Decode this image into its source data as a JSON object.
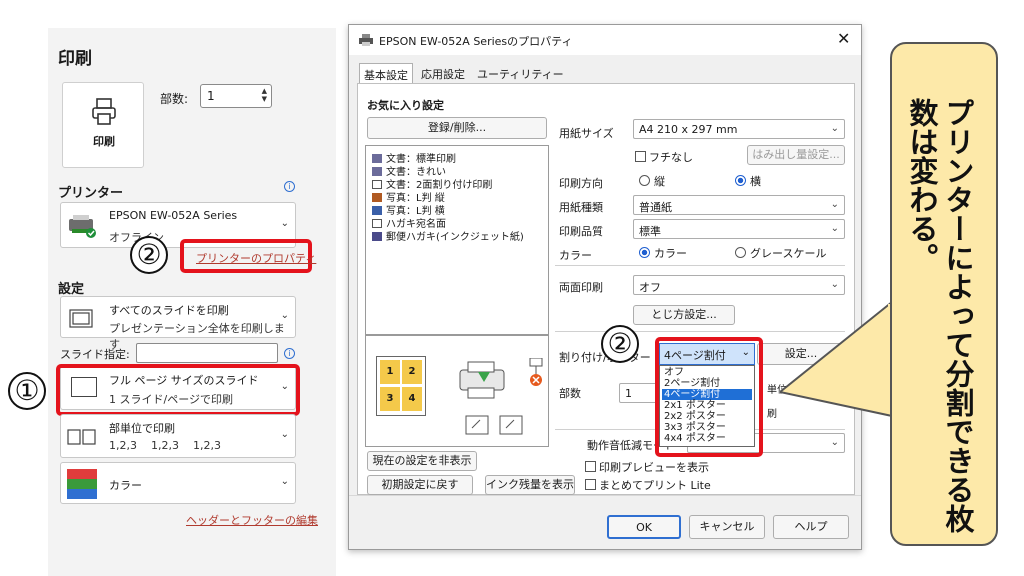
{
  "print_pane": {
    "title": "印刷",
    "print_button_label": "印刷",
    "copies_label": "部数:",
    "copies_value": "1",
    "printer_header": "プリンター",
    "printer_name": "EPSON EW-052A Series",
    "printer_status": "オフライン",
    "printer_properties_link": "プリンターのプロパティ",
    "settings_header": "設定",
    "slides_range_title": "すべてのスライドを印刷",
    "slides_range_desc": "プレゼンテーション全体を印刷します",
    "slide_spec_label": "スライド指定:",
    "layout_title": "フル ページ サイズのスライド",
    "layout_desc": "1 スライド/ページで印刷",
    "collate_title": "部単位で印刷",
    "collate_desc": "1,2,3    1,2,3    1,2,3",
    "color_label": "カラー",
    "header_footer_link": "ヘッダーとフッターの編集"
  },
  "dialog": {
    "title": "EPSON EW-052A Seriesのプロパティ",
    "close_glyph": "✕",
    "tabs": [
      "基本設定",
      "応用設定",
      "ユーティリティー"
    ],
    "favorites_label": "お気に入り設定",
    "register_button": "登録/削除...",
    "favorites": [
      {
        "label": "文書：標準印刷",
        "color": "#6b6b9a"
      },
      {
        "label": "文書：きれい",
        "color": "#6b6b9a"
      },
      {
        "label": "文書：2面割り付け印刷",
        "color": "#6b6b9a"
      },
      {
        "label": "写真：L判 縦",
        "color": "#b05a22"
      },
      {
        "label": "写真：L判 横",
        "color": "#3a5fa8"
      },
      {
        "label": "ハガキ宛名面",
        "color": "#ffffff"
      },
      {
        "label": "郵便ハガキ(インクジェット紙)",
        "color": "#4a4a8a"
      }
    ],
    "paper_size_label": "用紙サイズ",
    "paper_size_value": "A4 210 x 297 mm",
    "borderless_label": "フチなし",
    "overflow_button": "はみ出し量設定...",
    "orientation_label": "印刷方向",
    "orientation_portrait": "縦",
    "orientation_landscape": "横",
    "paper_type_label": "用紙種類",
    "paper_type_value": "普通紙",
    "quality_label": "印刷品質",
    "quality_value": "標準",
    "color_label": "カラー",
    "color_option": "カラー",
    "grayscale_option": "グレースケール",
    "duplex_label": "両面印刷",
    "duplex_value": "オフ",
    "binding_button": "とじ方設定...",
    "layout_label": "割り付け/ポスター",
    "layout_value": "4ページ割付",
    "layout_settings_button": "設定...",
    "layout_options": [
      "オフ",
      "2ページ割付",
      "4ページ割付",
      "2x1 ポスター",
      "2x2 ポスター",
      "3x3 ポスター",
      "4x4 ポスター"
    ],
    "copies_label": "部数",
    "copies_value": "1",
    "partial_reverse": "単位で印刷",
    "partial_reverse2": "刷",
    "quiet_label": "動作音低減モード",
    "preview_checkbox": "印刷プレビューを表示",
    "lite_checkbox": "まとめてプリント Lite",
    "hide_settings_button": "現在の設定を非表示",
    "reset_button": "初期設定に戻す",
    "ink_button": "インク残量を表示",
    "ok_button": "OK",
    "cancel_button": "キャンセル",
    "help_button": "ヘルプ",
    "preview_pages": [
      "1",
      "2",
      "3",
      "4"
    ]
  },
  "annotations": {
    "marker_1": "①",
    "marker_2": "②",
    "callout": "プリンターによって分割できる枚数は変わる。"
  }
}
